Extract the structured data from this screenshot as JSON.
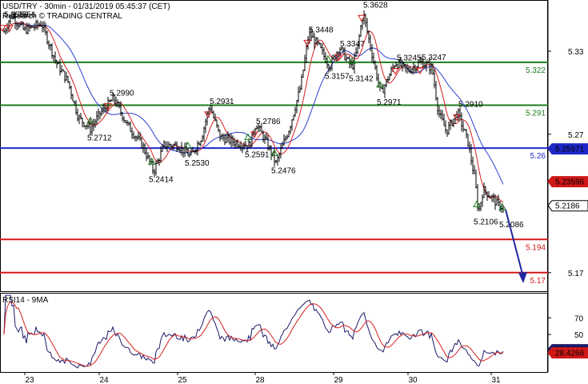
{
  "header": {
    "title": "USD/TRY - 30min - 01/31/2019 05:45:37 (CET)",
    "source": "Research © TRADING CENTRAL"
  },
  "colors": {
    "price": "#000000",
    "ma_red": "#d42020",
    "ma_blue": "#2a3fd0",
    "support_green": "#1e7d1e",
    "pivot_blue": "#1e28c8",
    "resistance_red": "#d01818",
    "rsi_line": "#1c1c6a",
    "rsi_ma": "#d42020"
  },
  "chart_data": [
    {
      "type": "line",
      "title": "USD/TRY - 30min - 01/31/2019 05:45:37 (CET)",
      "x_ticks": [
        "23",
        "24",
        "25",
        "28",
        "29",
        "30",
        "31"
      ],
      "y_ticks": [
        "5.33",
        "5.27",
        "5.17"
      ],
      "ylim": [
        5.156,
        5.367
      ],
      "horizontal_levels": [
        {
          "value": 5.322,
          "label": "5.322",
          "color": "green"
        },
        {
          "value": 5.291,
          "label": "5.291",
          "color": "green"
        },
        {
          "value": 5.26,
          "label": "5.26",
          "color": "blue"
        },
        {
          "value": 5.194,
          "label": "5.194",
          "color": "red"
        },
        {
          "value": 5.17,
          "label": "5.17",
          "color": "red"
        }
      ],
      "last_price_tags": [
        {
          "value": 5.25971,
          "label": "5.25971",
          "color": "blue"
        },
        {
          "value": 5.23596,
          "label": "5.23596",
          "color": "red"
        },
        {
          "value": 5.2186,
          "label": "5.2186",
          "color": "black"
        }
      ],
      "swing_labels": [
        {
          "x": 3,
          "value": 5.3556,
          "label": "5.3556",
          "kind": "high"
        },
        {
          "x": 12,
          "value": 5.3556,
          "label": "5.3556",
          "kind": "high"
        },
        {
          "x": 135,
          "value": 5.299,
          "label": "5.2990",
          "kind": "high"
        },
        {
          "x": 113,
          "value": 5.2712,
          "label": "5.2712",
          "kind": "low"
        },
        {
          "x": 190,
          "value": 5.2414,
          "label": "5.2414",
          "kind": "low"
        },
        {
          "x": 235,
          "value": 5.253,
          "label": "5.2530",
          "kind": "low"
        },
        {
          "x": 260,
          "value": 5.2931,
          "label": "5.2931",
          "kind": "high"
        },
        {
          "x": 310,
          "value": 5.2591,
          "label": "5.2591",
          "kind": "low"
        },
        {
          "x": 318,
          "value": 5.2786,
          "label": "5.2786",
          "kind": "high"
        },
        {
          "x": 343,
          "value": 5.2476,
          "label": "5.2476",
          "kind": "low"
        },
        {
          "x": 384,
          "value": 5.3448,
          "label": "5.3448",
          "kind": "high"
        },
        {
          "x": 410,
          "value": 5.3157,
          "label": "5.3157",
          "kind": "low"
        },
        {
          "x": 423,
          "value": 5.3347,
          "label": "5.3347",
          "kind": "high"
        },
        {
          "x": 440,
          "value": 5.3142,
          "label": "5.3142",
          "kind": "low"
        },
        {
          "x": 452,
          "value": 5.3628,
          "label": "5.3628",
          "kind": "high"
        },
        {
          "x": 475,
          "value": 5.2971,
          "label": "5.2971",
          "kind": "low"
        },
        {
          "x": 494,
          "value": 5.3245,
          "label": "5.3245",
          "kind": "high"
        },
        {
          "x": 525,
          "value": 5.3247,
          "label": "5.3247",
          "kind": "high"
        },
        {
          "x": 571,
          "value": 5.291,
          "label": "5.2910",
          "kind": "high"
        },
        {
          "x": 596,
          "value": 5.2106,
          "label": "5.2106",
          "kind": "low"
        },
        {
          "x": 628,
          "value": 5.2086,
          "label": "5.2086",
          "kind": "low"
        }
      ],
      "forecast_arrow": {
        "from": 5.2186,
        "to": 5.17
      }
    },
    {
      "type": "line",
      "title": "RSI14 - 9MA",
      "y_ticks": [
        "70",
        "50"
      ],
      "ylim": [
        5,
        100
      ],
      "last_value_tags": [
        {
          "value": 32.2422,
          "label": "32.2422",
          "color": "navy"
        },
        {
          "value": 28.4266,
          "label": "28.4266",
          "color": "red"
        }
      ]
    }
  ]
}
